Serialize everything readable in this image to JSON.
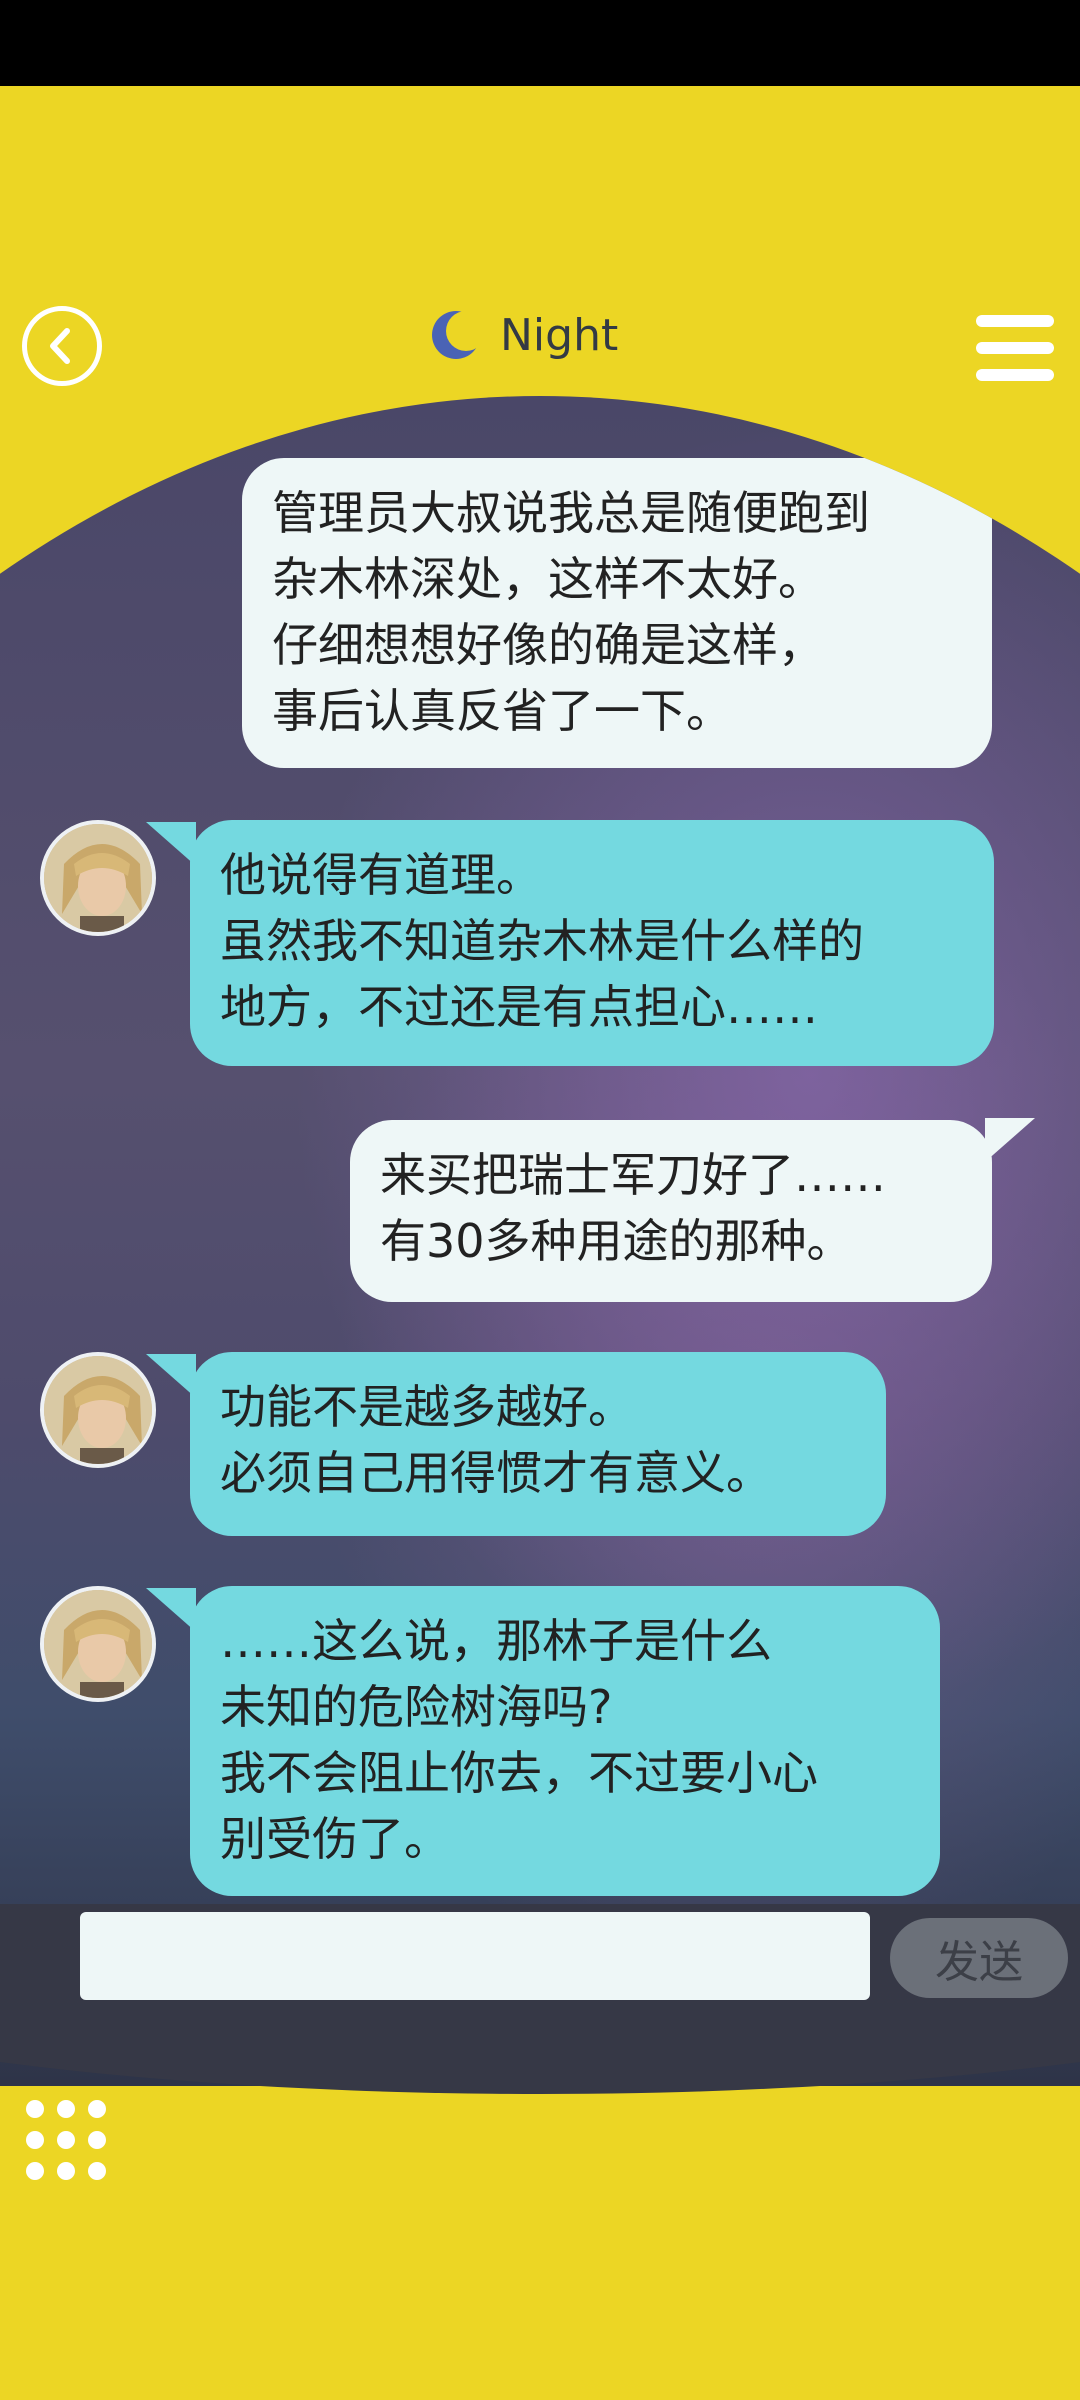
{
  "header": {
    "title": "Night"
  },
  "input": {
    "placeholder": "",
    "send_label": "发送"
  },
  "messages": [
    {
      "side": "me",
      "lines": [
        "管理员大叔说我总是随便跑到",
        "杂木林深处，这样不太好。",
        "仔细想想好像的确是这样，",
        "事后认真反省了一下。"
      ]
    },
    {
      "side": "them",
      "lines": [
        "他说得有道理。",
        "虽然我不知道杂木林是什么样的",
        "地方，不过还是有点担心……"
      ]
    },
    {
      "side": "me",
      "lines": [
        "来买把瑞士军刀好了……",
        "有30多种用途的那种。"
      ]
    },
    {
      "side": "them",
      "lines": [
        "功能不是越多越好。",
        "必须自己用得惯才有意义。"
      ]
    },
    {
      "side": "them",
      "lines": [
        "……这么说，那林子是什么",
        "未知的危险树海吗?",
        "我不会阻止你去，不过要小心",
        "别受伤了。"
      ]
    }
  ],
  "colors": {
    "page_bg": "#ecd624",
    "my_bubble": "#eef7f7",
    "their_bubble": "#74d9e0",
    "send_button": "#6b7079"
  },
  "icons": {
    "back": "chevron-left-icon",
    "moon": "moon-icon",
    "menu": "hamburger-menu-icon",
    "grid": "dots-grid-icon"
  }
}
